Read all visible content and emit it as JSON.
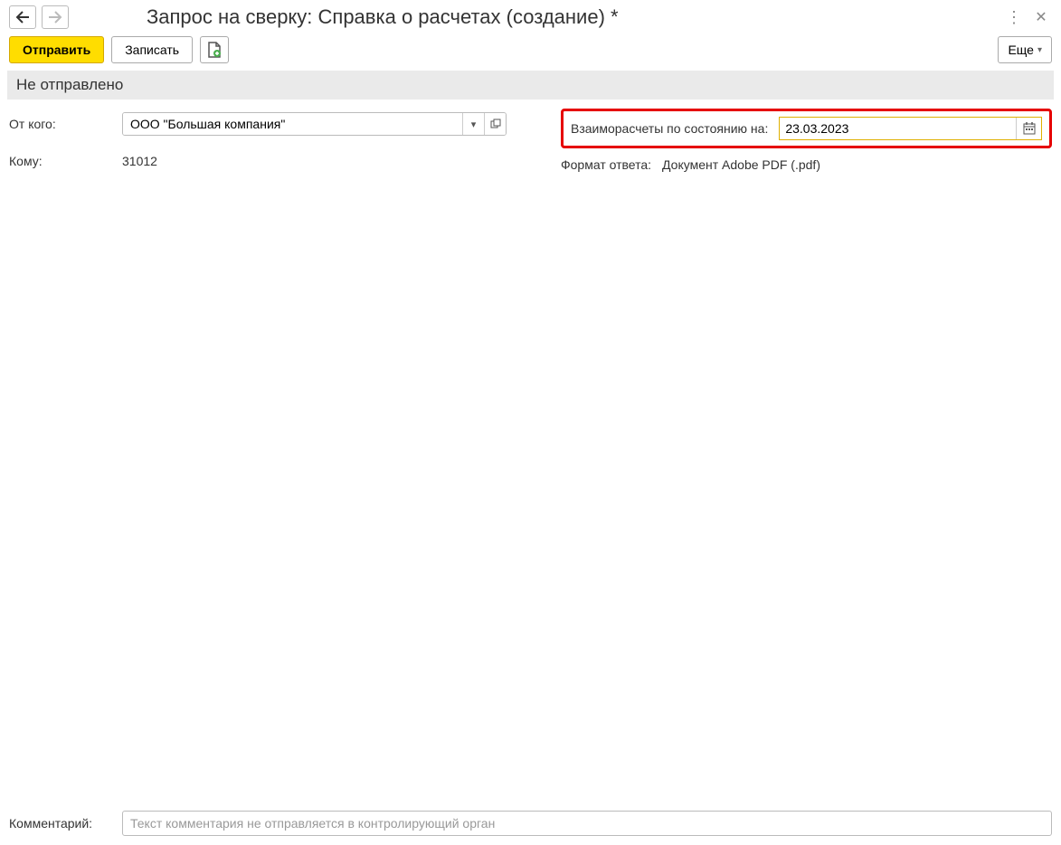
{
  "header": {
    "title": "Запрос на сверку: Справка о расчетах (создание) *"
  },
  "toolbar": {
    "send_label": "Отправить",
    "save_label": "Записать",
    "more_label": "Еще"
  },
  "status": {
    "text": "Не отправлено"
  },
  "form": {
    "from_label": "От кого:",
    "from_value": "ООО \"Большая компания\"",
    "to_label": "Кому:",
    "to_value": "31012",
    "settlements_label": "Взаиморасчеты по состоянию на:",
    "date_value": "23.03.2023",
    "format_label": "Формат ответа:",
    "format_value": "Документ Adobe PDF (.pdf)"
  },
  "comment": {
    "label": "Комментарий:",
    "placeholder": "Текст комментария не отправляется в контролирующий орган"
  }
}
